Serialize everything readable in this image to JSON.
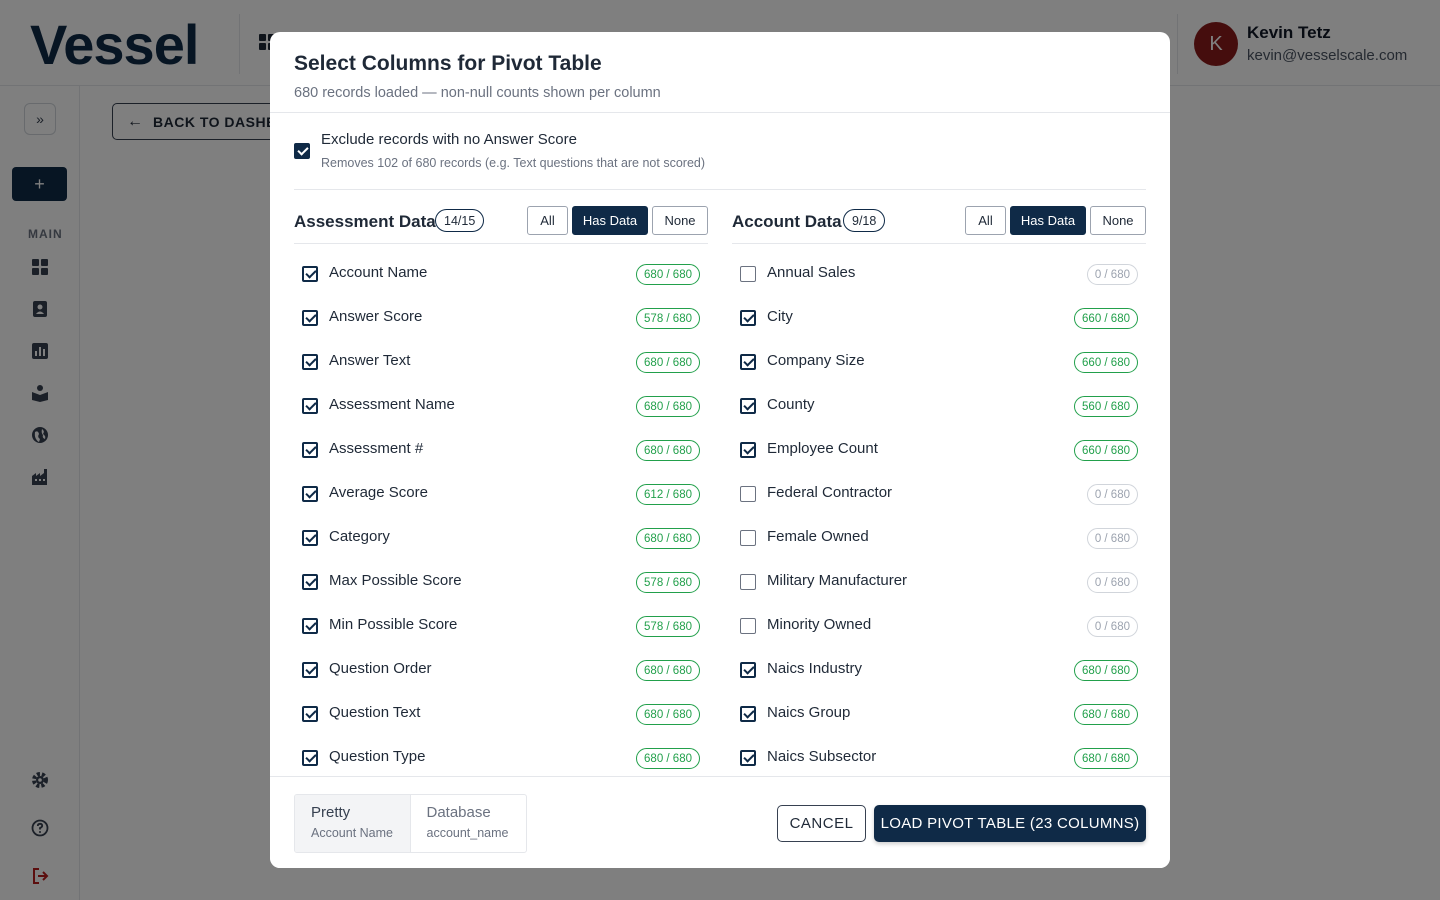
{
  "app": {
    "logo_text": "Vessel",
    "user": {
      "initial": "K",
      "name": "Kevin Tetz",
      "email": "kevin@vesselscale.com"
    }
  },
  "sidebar": {
    "new_button": "+",
    "section_label": "MAIN",
    "nav_icons": [
      "dashboard-icon",
      "contacts-icon",
      "chart-icon",
      "learning-icon",
      "globe-icon",
      "factory-icon"
    ],
    "bottom_icons": [
      "settings-icon",
      "help-icon",
      "logout-icon"
    ]
  },
  "page": {
    "back_button": "BACK TO DASHBOARD"
  },
  "modal": {
    "title": "Select Columns for Pivot Table",
    "subtitle": "680 records loaded — non-null counts shown per column",
    "exclude": {
      "checked": true,
      "label": "Exclude records with no Answer Score",
      "note": "Removes 102 of 680 records (e.g. Text questions that are not scored)"
    },
    "filters": {
      "all": "All",
      "has_data": "Has Data",
      "none": "None",
      "active": "has_data"
    },
    "assessment": {
      "title": "Assessment Data",
      "count": "14/15",
      "columns": [
        {
          "label": "Account Name",
          "count": "680 / 680",
          "checked": true
        },
        {
          "label": "Answer Score",
          "count": "578 / 680",
          "checked": true
        },
        {
          "label": "Answer Text",
          "count": "680 / 680",
          "checked": true
        },
        {
          "label": "Assessment Name",
          "count": "680 / 680",
          "checked": true
        },
        {
          "label": "Assessment #",
          "count": "680 / 680",
          "checked": true
        },
        {
          "label": "Average Score",
          "count": "612 / 680",
          "checked": true
        },
        {
          "label": "Category",
          "count": "680 / 680",
          "checked": true
        },
        {
          "label": "Max Possible Score",
          "count": "578 / 680",
          "checked": true
        },
        {
          "label": "Min Possible Score",
          "count": "578 / 680",
          "checked": true
        },
        {
          "label": "Question Order",
          "count": "680 / 680",
          "checked": true
        },
        {
          "label": "Question Text",
          "count": "680 / 680",
          "checked": true
        },
        {
          "label": "Question Type",
          "count": "680 / 680",
          "checked": true
        }
      ]
    },
    "account": {
      "title": "Account Data",
      "count": "9/18",
      "columns": [
        {
          "label": "Annual Sales",
          "count": "0 / 680",
          "checked": false
        },
        {
          "label": "City",
          "count": "660 / 680",
          "checked": true
        },
        {
          "label": "Company Size",
          "count": "660 / 680",
          "checked": true
        },
        {
          "label": "County",
          "count": "560 / 680",
          "checked": true
        },
        {
          "label": "Employee Count",
          "count": "660 / 680",
          "checked": true
        },
        {
          "label": "Federal Contractor",
          "count": "0 / 680",
          "checked": false
        },
        {
          "label": "Female Owned",
          "count": "0 / 680",
          "checked": false
        },
        {
          "label": "Military Manufacturer",
          "count": "0 / 680",
          "checked": false
        },
        {
          "label": "Minority Owned",
          "count": "0 / 680",
          "checked": false
        },
        {
          "label": "Naics Industry",
          "count": "680 / 680",
          "checked": true
        },
        {
          "label": "Naics Group",
          "count": "680 / 680",
          "checked": true
        },
        {
          "label": "Naics Subsector",
          "count": "680 / 680",
          "checked": true
        }
      ]
    },
    "name_format": {
      "active": "pretty",
      "pretty": {
        "label": "Pretty",
        "example": "Account Name"
      },
      "database": {
        "label": "Database",
        "example": "account_name"
      }
    },
    "cancel_button": "CANCEL",
    "load_button": "LOAD PIVOT TABLE (23 COLUMNS)"
  },
  "colors": {
    "brand_navy": "#0f2a47",
    "badge_green": "#22a04b",
    "avatar": "#8b1a1a"
  }
}
